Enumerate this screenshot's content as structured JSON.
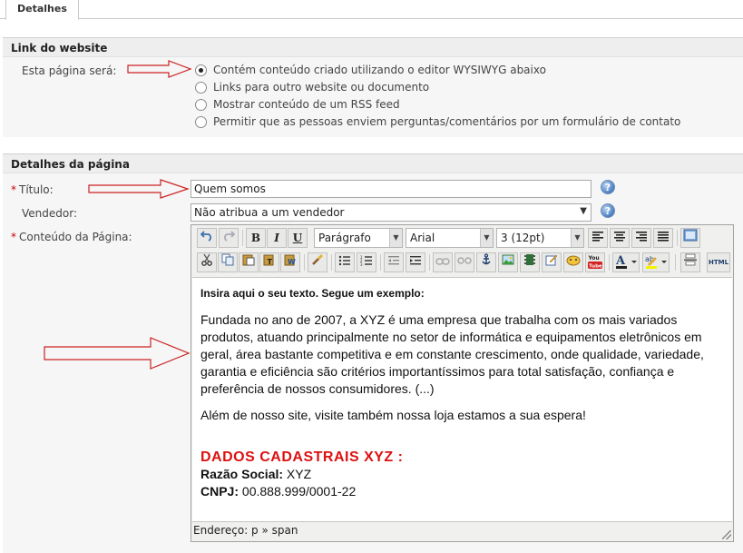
{
  "tabs": [
    "Detalhes"
  ],
  "website_section": {
    "title": "Link do website",
    "field_label": "Esta página será:",
    "options": [
      {
        "label": "Contém conteúdo criado utilizando o editor WYSIWYG abaixo",
        "checked": true
      },
      {
        "label": "Links para outro website ou documento",
        "checked": false
      },
      {
        "label": "Mostrar conteúdo de um RSS feed",
        "checked": false
      },
      {
        "label": "Permitir que as pessoas enviem perguntas/comentários por um formulário de contato",
        "checked": false
      }
    ]
  },
  "page_section": {
    "title": "Detalhes da página",
    "required_mark": "*",
    "title_label": "Título:",
    "title_value": "Quem somos",
    "seller_label": "Vendedor:",
    "seller_value": "Não atribua a um vendedor",
    "content_label": "Conteúdo da Página:",
    "help_glyph": "?"
  },
  "editor": {
    "format_select": "Parágrafo",
    "font_select": "Arial",
    "size_select": "3 (12pt)",
    "toolbar_icons_row1": [
      "undo-icon",
      "redo-icon",
      "bold-icon",
      "italic-icon",
      "underline-icon",
      "align-left-icon",
      "align-center-icon",
      "align-right-icon",
      "align-justify-icon",
      "source-view-icon"
    ],
    "toolbar_icons_row2": [
      "cut-icon",
      "copy-icon",
      "paste-icon",
      "paste-text-icon",
      "paste-word-icon",
      "cleanup-icon",
      "bullet-list-icon",
      "numbered-list-icon",
      "outdent-icon",
      "indent-icon",
      "link-icon",
      "unlink-icon",
      "anchor-icon",
      "image-icon",
      "media-icon",
      "edit-icon",
      "emoticon-icon",
      "youtube-icon",
      "text-color-icon",
      "highlight-color-icon",
      "horizontal-rule-icon",
      "html-icon"
    ],
    "button_letters": {
      "bold": "B",
      "italic": "I",
      "underline": "U",
      "html": "HTML",
      "youtube": "You Tube"
    },
    "intro": "Insira aqui o seu texto. Segue um exemplo:",
    "paragraph1": "Fundada no ano de 2007, a XYZ é uma empresa que trabalha com os mais variados produtos, atuando principalmente no setor de informática e equipamentos eletrônicos em geral, área bastante competitiva e em constante crescimento, onde qualidade, variedade, garantia e eficiência são critérios importantíssimos para total satisfação, confiança e preferência de nossos consumidores. (...)",
    "paragraph2": "Além de nosso site, visite também nossa loja estamos a sua espera!",
    "heading": "DADOS CADASTRAIS XYZ :",
    "razao_label": "Razão Social:",
    "razao_value": "XYZ",
    "cnpj_label": "CNPJ:",
    "cnpj_value": "00.888.999/0001-22",
    "status_path": "Endereço: p » span"
  },
  "colors": {
    "heading_red": "#dd1111",
    "arrow_red": "#cc2222",
    "section_bg": "#eeeeee"
  }
}
